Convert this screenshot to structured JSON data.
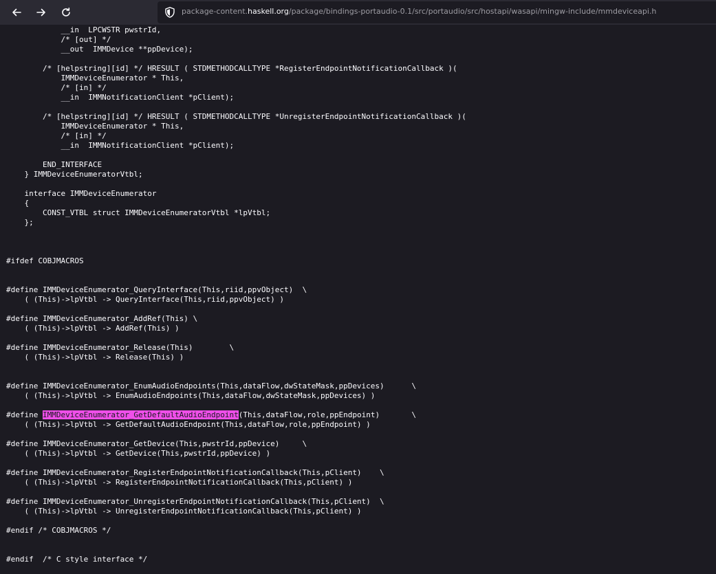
{
  "browser": {
    "url_scheme_prefix": "",
    "url_before_host": "package-content.",
    "url_host": "haskell.org",
    "url_path": "/package/bindings-portaudio-0.1/src/portaudio/src/hostapi/wasapi/mingw-include/mmdeviceapi.h",
    "icons": {
      "back": "arrow-left-icon",
      "forward": "arrow-right-icon",
      "reload": "reload-icon",
      "security": "shield-icon"
    }
  },
  "code": {
    "highlight_term": "IMMDeviceEnumerator_GetDefaultAudioEndpoint",
    "lines": [
      "            __in  LPCWSTR pwstrId,",
      "            /* [out] */",
      "            __out  IMMDevice **ppDevice);",
      "",
      "        /* [helpstring][id] */ HRESULT ( STDMETHODCALLTYPE *RegisterEndpointNotificationCallback )(",
      "            IMMDeviceEnumerator * This,",
      "            /* [in] */",
      "            __in  IMMNotificationClient *pClient);",
      "",
      "        /* [helpstring][id] */ HRESULT ( STDMETHODCALLTYPE *UnregisterEndpointNotificationCallback )(",
      "            IMMDeviceEnumerator * This,",
      "            /* [in] */",
      "            __in  IMMNotificationClient *pClient);",
      "",
      "        END_INTERFACE",
      "    } IMMDeviceEnumeratorVtbl;",
      "",
      "    interface IMMDeviceEnumerator",
      "    {",
      "        CONST_VTBL struct IMMDeviceEnumeratorVtbl *lpVtbl;",
      "    };",
      "",
      "",
      "",
      "#ifdef COBJMACROS",
      "",
      "",
      "#define IMMDeviceEnumerator_QueryInterface(This,riid,ppvObject)  \\",
      "    ( (This)->lpVtbl -> QueryInterface(This,riid,ppvObject) )",
      "",
      "#define IMMDeviceEnumerator_AddRef(This) \\",
      "    ( (This)->lpVtbl -> AddRef(This) )",
      "",
      "#define IMMDeviceEnumerator_Release(This)        \\",
      "    ( (This)->lpVtbl -> Release(This) )",
      "",
      "",
      "#define IMMDeviceEnumerator_EnumAudioEndpoints(This,dataFlow,dwStateMask,ppDevices)      \\",
      "    ( (This)->lpVtbl -> EnumAudioEndpoints(This,dataFlow,dwStateMask,ppDevices) )",
      "",
      "#define IMMDeviceEnumerator_GetDefaultAudioEndpoint(This,dataFlow,role,ppEndpoint)       \\",
      "    ( (This)->lpVtbl -> GetDefaultAudioEndpoint(This,dataFlow,role,ppEndpoint) )",
      "",
      "#define IMMDeviceEnumerator_GetDevice(This,pwstrId,ppDevice)     \\",
      "    ( (This)->lpVtbl -> GetDevice(This,pwstrId,ppDevice) )",
      "",
      "#define IMMDeviceEnumerator_RegisterEndpointNotificationCallback(This,pClient)    \\",
      "    ( (This)->lpVtbl -> RegisterEndpointNotificationCallback(This,pClient) )",
      "",
      "#define IMMDeviceEnumerator_UnregisterEndpointNotificationCallback(This,pClient)  \\",
      "    ( (This)->lpVtbl -> UnregisterEndpointNotificationCallback(This,pClient) )",
      "",
      "#endif /* COBJMACROS */",
      "",
      "",
      "#endif  /* C style interface */"
    ]
  },
  "colors": {
    "page_bg": "#1c1b22",
    "toolbar_bg": "#2b2a33",
    "text": "#fbfbfe",
    "highlight_bg": "#ef4fe9"
  }
}
